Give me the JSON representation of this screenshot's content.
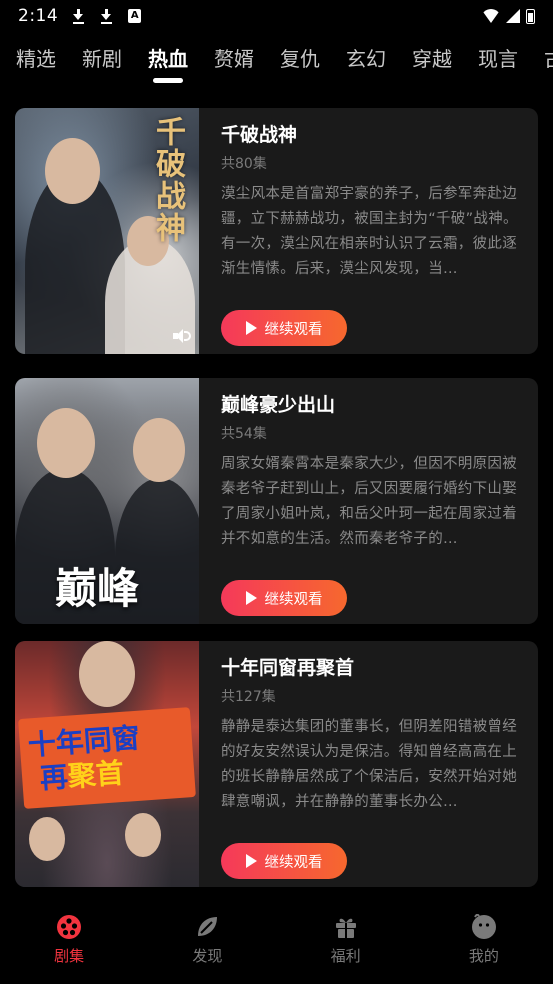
{
  "status_bar": {
    "time": "2:14",
    "icons": [
      "download-icon",
      "download-icon",
      "a-icon",
      "wifi-icon",
      "signal-icon",
      "battery-icon"
    ]
  },
  "tabs": [
    {
      "label": "精选",
      "active": false
    },
    {
      "label": "新剧",
      "active": false
    },
    {
      "label": "热血",
      "active": true
    },
    {
      "label": "赘婿",
      "active": false
    },
    {
      "label": "复仇",
      "active": false
    },
    {
      "label": "玄幻",
      "active": false
    },
    {
      "label": "穿越",
      "active": false
    },
    {
      "label": "现言",
      "active": false
    },
    {
      "label": "古",
      "active": false
    }
  ],
  "dramas": [
    {
      "title": "千破战神",
      "episodes": "共80集",
      "description": "漠尘风本是首富郑宇豪的养子，后参军奔赴边疆，立下赫赫战功，被国主封为“千破”战神。有一次，漠尘风在相亲时认识了云霜，彼此逐渐生情愫。后来，漠尘风发现，当…",
      "button_label": "继续观看",
      "poster_art": "千破战神"
    },
    {
      "title": "巅峰豪少出山",
      "episodes": "共54集",
      "description": "周家女婿秦霄本是秦家大少，但因不明原因被秦老爷子赶到山上，后又因要履行婚约下山娶了周家小姐叶岚，和岳父叶珂一起在周家过着并不如意的生活。然而秦老爷子的…",
      "button_label": "继续观看",
      "poster_art": "巅峰"
    },
    {
      "title": "十年同窗再聚首",
      "episodes": "共127集",
      "description": "静静是泰达集团的董事长，但阴差阳错被曾经的好友安然误认为是保洁。得知曾经高高在上的班长静静居然成了个保洁后，安然开始对她肆意嘲讽，并在静静的董事长办公…",
      "button_label": "继续观看",
      "poster_art_line1": "十年同窗",
      "poster_art_line2a": "再",
      "poster_art_line2b": "聚首"
    }
  ],
  "bottom_nav": [
    {
      "label": "剧集",
      "icon": "film-reel-icon",
      "active": true
    },
    {
      "label": "发现",
      "icon": "discover-leaf-icon",
      "active": false
    },
    {
      "label": "福利",
      "icon": "gift-icon",
      "active": false
    },
    {
      "label": "我的",
      "icon": "profile-icon",
      "active": false
    }
  ],
  "colors": {
    "accent": "#f2343f",
    "button_gradient_start": "#f5395a",
    "button_gradient_end": "#f6682e",
    "card_background": "#1a1a1a",
    "background": "#000000"
  }
}
